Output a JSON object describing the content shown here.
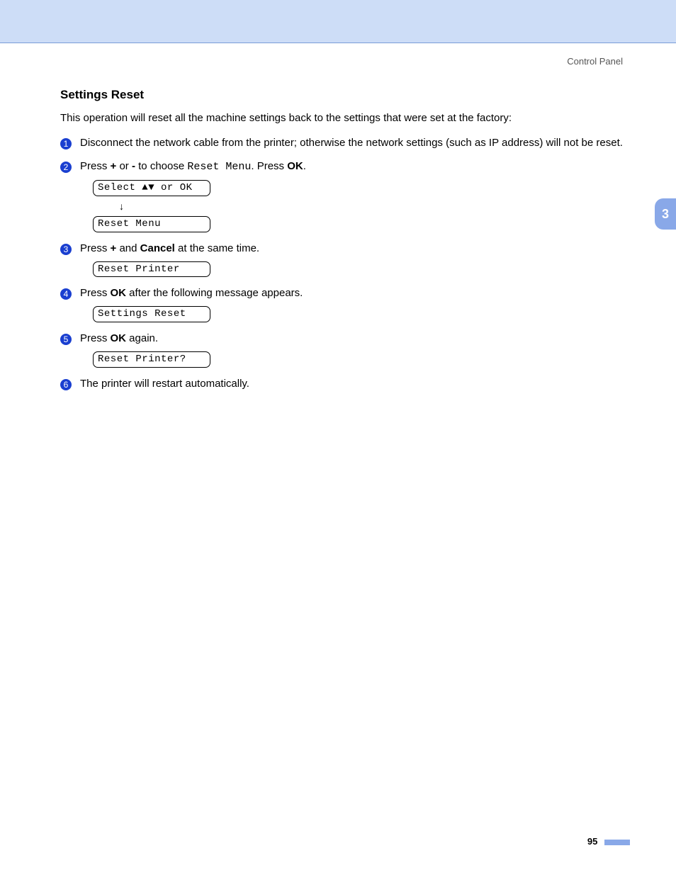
{
  "header": {
    "breadcrumb": "Control Panel"
  },
  "section": {
    "title": "Settings Reset",
    "intro": "This operation will reset all the machine settings back to the settings that were set at the factory:"
  },
  "steps": {
    "s1": {
      "num": "1",
      "text": "Disconnect the network cable from the printer; otherwise the network settings (such as IP address) will not be reset."
    },
    "s2": {
      "num": "2",
      "prefix": "Press ",
      "b1": "+",
      "mid1": " or ",
      "b2": "-",
      "mid2": " to choose ",
      "code": "Reset Menu",
      "mid3": ". Press ",
      "b3": "OK",
      "suffix": ".",
      "lcd1": "Select ▲▼ or OK",
      "arrow": "↓",
      "lcd2": "Reset Menu"
    },
    "s3": {
      "num": "3",
      "prefix": "Press ",
      "b1": "+",
      "mid1": " and ",
      "b2": "Cancel",
      "suffix": " at the same time.",
      "lcd": "Reset Printer"
    },
    "s4": {
      "num": "4",
      "prefix": "Press ",
      "b1": "OK",
      "suffix": " after the following message appears.",
      "lcd": "Settings Reset"
    },
    "s5": {
      "num": "5",
      "prefix": "Press ",
      "b1": "OK",
      "suffix": " again.",
      "lcd": "Reset Printer?"
    },
    "s6": {
      "num": "6",
      "text": "The printer will restart automatically."
    }
  },
  "sideTab": "3",
  "pageNumber": "95"
}
